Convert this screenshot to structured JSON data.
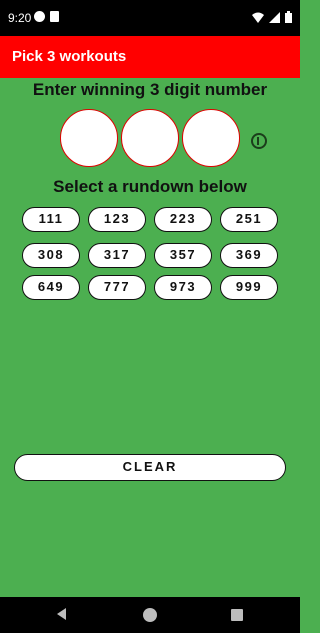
{
  "status_bar": {
    "time": "9:20",
    "left_icons": [
      "notification-circle-icon",
      "sim-card-icon"
    ],
    "right_icons": [
      "wifi-icon",
      "signal-icon",
      "battery-icon"
    ]
  },
  "app_bar": {
    "title": "Pick 3 workouts"
  },
  "prompt": "Enter winning 3 digit number",
  "digit_inputs": [
    "",
    "",
    ""
  ],
  "info_icon": "info-icon",
  "select_label": "Select a rundown below",
  "rundowns": [
    [
      "111",
      "123",
      "223",
      "251"
    ],
    [
      "308",
      "317",
      "357",
      "369"
    ],
    [
      "649",
      "777",
      "973",
      "999"
    ]
  ],
  "clear_label": "CLEAR",
  "colors": {
    "background": "#4caf50",
    "app_bar": "#ff0000",
    "circle_border": "#e00000"
  },
  "nav_bar": {
    "icons": [
      "back-icon",
      "home-icon",
      "recents-icon"
    ]
  }
}
